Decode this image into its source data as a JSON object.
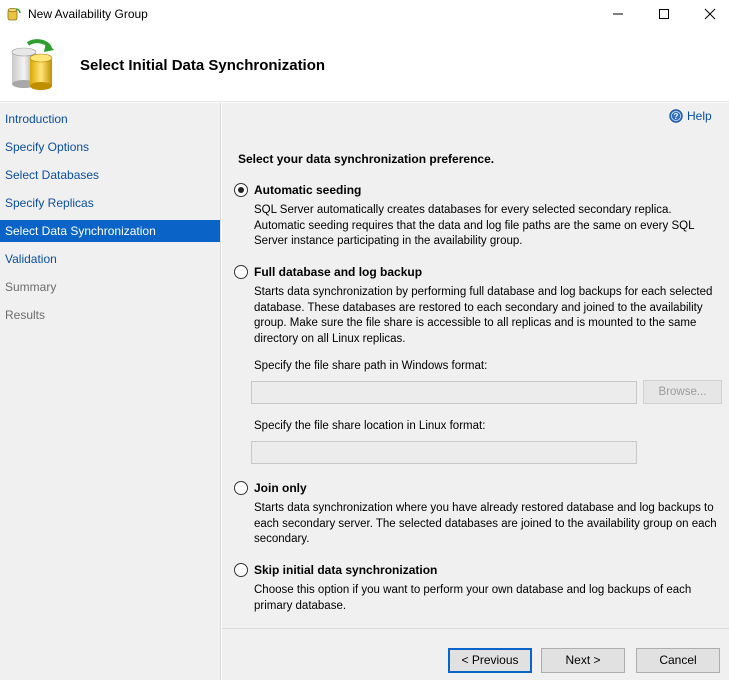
{
  "window": {
    "title": "New Availability Group",
    "minimize_icon": "minimize-icon",
    "maximize_icon": "maximize-icon",
    "close_icon": "close-icon"
  },
  "header": {
    "title": "Select Initial Data Synchronization",
    "logo_icon": "database-sync-icon"
  },
  "sidebar": {
    "items": [
      {
        "label": "Introduction",
        "state": "link"
      },
      {
        "label": "Specify Options",
        "state": "link"
      },
      {
        "label": "Select Databases",
        "state": "link"
      },
      {
        "label": "Specify Replicas",
        "state": "link"
      },
      {
        "label": "Select Data Synchronization",
        "state": "selected"
      },
      {
        "label": "Validation",
        "state": "link"
      },
      {
        "label": "Summary",
        "state": "disabled"
      },
      {
        "label": "Results",
        "state": "disabled"
      }
    ]
  },
  "main": {
    "help_label": "Help",
    "prompt": "Select your data synchronization preference.",
    "options": [
      {
        "label": "Automatic seeding",
        "selected": true,
        "description": "SQL Server automatically creates databases for every selected secondary replica. Automatic seeding requires that the data and log file paths are the same on every SQL Server instance participating in the availability group."
      },
      {
        "label": "Full database and log backup",
        "selected": false,
        "description": "Starts data synchronization by performing full database and log backups for each selected database. These databases are restored to each secondary and joined to the availability group. Make sure the file share is accessible to all replicas and is mounted to the same directory on all Linux replicas."
      },
      {
        "label": "Join only",
        "selected": false,
        "description": "Starts data synchronization where you have already restored database and log backups to each secondary server. The selected databases are joined to the availability group on each secondary."
      },
      {
        "label": "Skip initial data synchronization",
        "selected": false,
        "description": "Choose this option if you want to perform your own database and log backups of each primary database."
      }
    ],
    "windows_share_label": "Specify the file share path in Windows format:",
    "windows_share_value": "",
    "browse_label": "Browse...",
    "linux_share_label": "Specify the file share location in Linux format:",
    "linux_share_value": ""
  },
  "footer": {
    "previous_label": "< Previous",
    "next_label": "Next >",
    "cancel_label": "Cancel"
  },
  "colors": {
    "accent": "#0a64c8",
    "link": "#0b4fa0",
    "panel": "#f0f0f0"
  }
}
